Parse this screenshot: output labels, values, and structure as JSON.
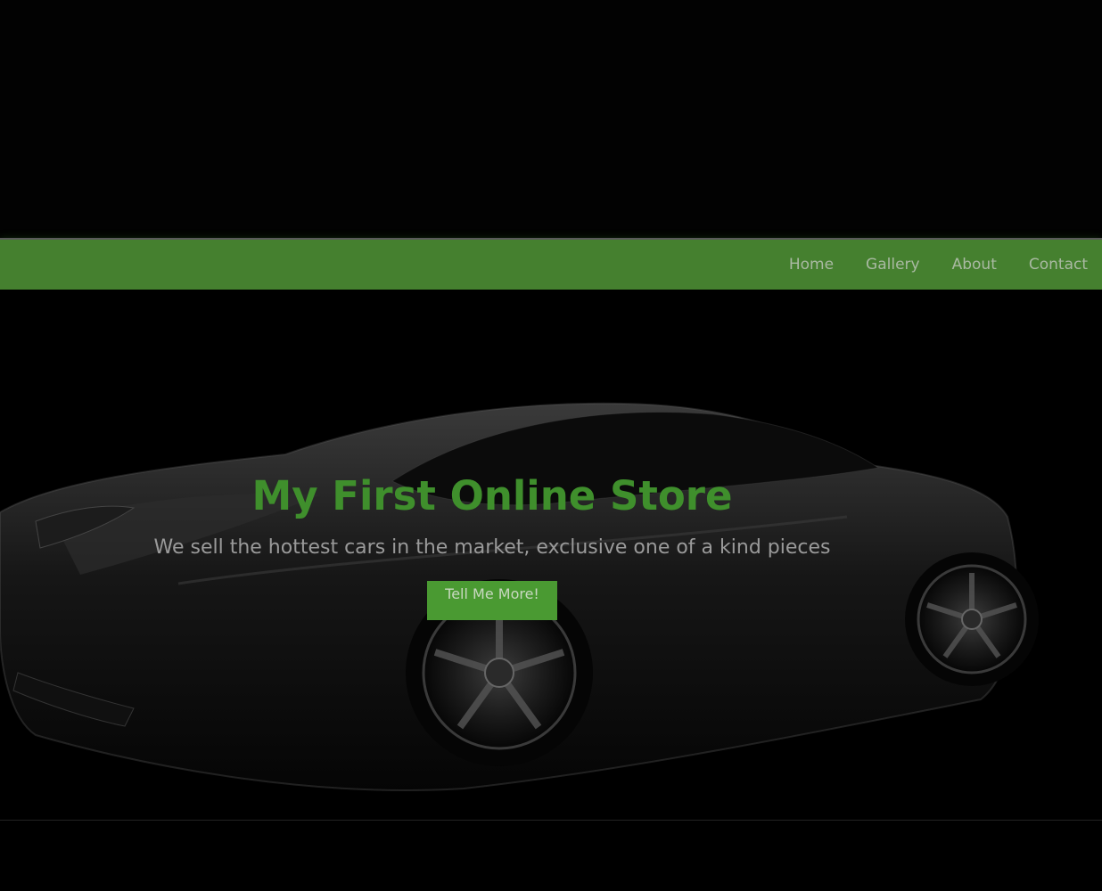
{
  "nav": {
    "items": [
      {
        "label": "Home"
      },
      {
        "label": "Gallery"
      },
      {
        "label": "About"
      },
      {
        "label": "Contact"
      }
    ]
  },
  "hero": {
    "title": "My First Online Store",
    "subtitle": "We sell the hottest cars in the market, exclusive one of a kind pieces",
    "button_label": "Tell Me More!",
    "background_image": "black-sports-car-icon"
  },
  "colors": {
    "navbar": "#45802f",
    "accent": "#3f8f2c",
    "button": "#4a9a32",
    "background": "#000000"
  }
}
